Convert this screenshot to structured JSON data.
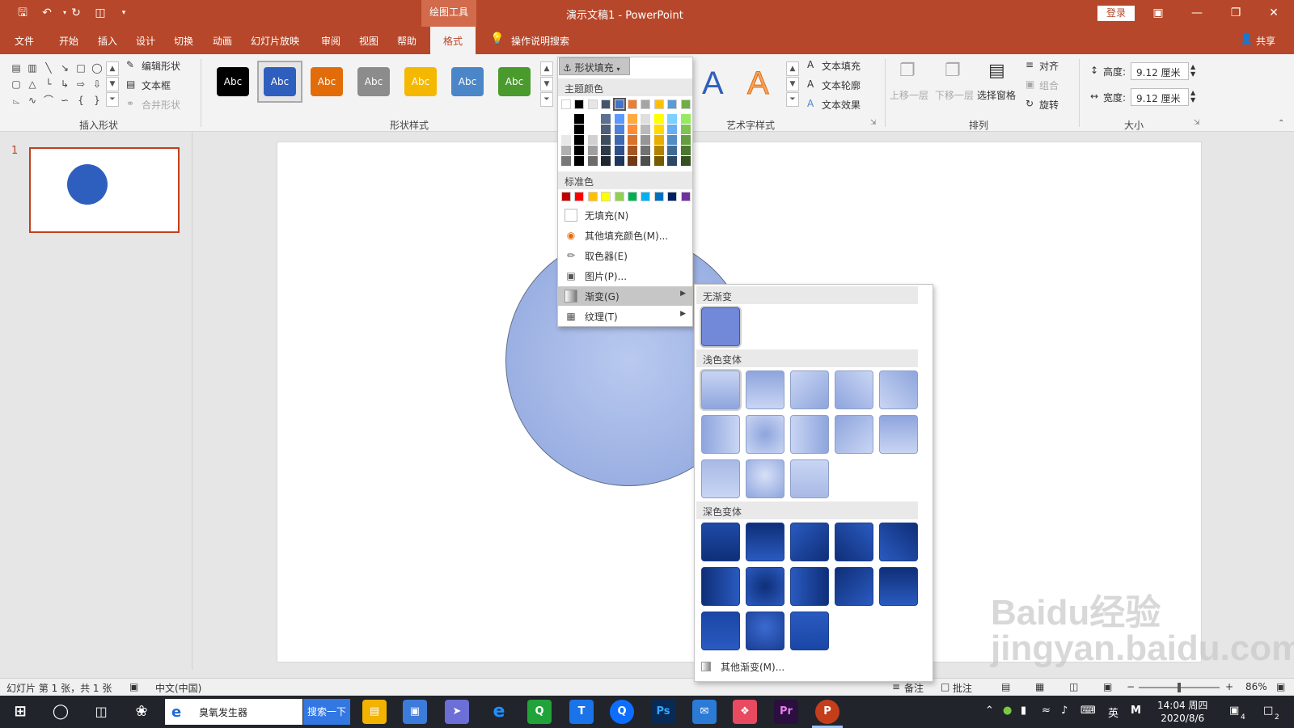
{
  "titlebar": {
    "context_tool": "绘图工具",
    "title": "演示文稿1 - PowerPoint",
    "login_label": "登录"
  },
  "tabs": [
    {
      "label": "文件"
    },
    {
      "label": "开始"
    },
    {
      "label": "插入"
    },
    {
      "label": "设计"
    },
    {
      "label": "切换"
    },
    {
      "label": "动画"
    },
    {
      "label": "幻灯片放映"
    },
    {
      "label": "审阅"
    },
    {
      "label": "视图"
    },
    {
      "label": "帮助"
    },
    {
      "label": "格式",
      "active": true
    }
  ],
  "search_label": "操作说明搜索",
  "share_label": "共享",
  "ribbon": {
    "insert_shapes": {
      "label": "插入形状",
      "edit_shape": "编辑形状",
      "text_box": "文本框",
      "merge_shapes": "合并形状"
    },
    "shape_styles": {
      "label": "形状样式",
      "abc_text": "Abc",
      "swatches": [
        "#000000",
        "#2f5fbe",
        "#e36c0a",
        "#8c8c8c",
        "#f5b800",
        "#4a86c8",
        "#4a9a2e"
      ]
    },
    "fill_button": "形状填充",
    "wordart": {
      "label": "艺术字样式",
      "text_fill": "文本填充",
      "text_outline": "文本轮廓",
      "text_effects": "文本效果"
    },
    "arrange": {
      "label": "排列",
      "bring_forward": "上移一层",
      "send_backward": "下移一层",
      "selection_pane": "选择窗格",
      "align": "对齐",
      "group": "组合",
      "rotate": "旋转"
    },
    "size": {
      "label": "大小",
      "height_label": "高度:",
      "height_value": "9.12 厘米",
      "width_label": "宽度:",
      "width_value": "9.12 厘米"
    }
  },
  "slide_panel": {
    "slide_number": "1"
  },
  "fill_menu": {
    "theme_colors_label": "主题颜色",
    "theme_colors": [
      "#ffffff",
      "#000000",
      "#e7e6e6",
      "#44546a",
      "#4472c4",
      "#ed7d31",
      "#a5a5a5",
      "#ffc000",
      "#5b9bd5",
      "#70ad47"
    ],
    "standard_colors_label": "标准色",
    "standard_colors": [
      "#c00000",
      "#ff0000",
      "#ffc000",
      "#ffff00",
      "#92d050",
      "#00b050",
      "#00b0f0",
      "#0070c0",
      "#002060",
      "#7030a0"
    ],
    "no_fill": "无填充(N)",
    "more_colors": "其他填充颜色(M)...",
    "eyedropper": "取色器(E)",
    "picture": "图片(P)...",
    "gradient": "渐变(G)",
    "texture": "纹理(T)"
  },
  "gradient_menu": {
    "no_gradient": "无渐变",
    "light_variations": "浅色变体",
    "dark_variations": "深色变体",
    "more_gradients": "其他渐变(M)..."
  },
  "statusbar": {
    "slide_info": "幻灯片 第 1 张，共 1 张",
    "language": "中文(中国)",
    "notes": "备注",
    "comments": "批注",
    "zoom": "86%"
  },
  "taskbar": {
    "search_text": "臭氧发生器",
    "search_button": "搜索一下",
    "ime": "英",
    "time": "14:04 周四",
    "date": "2020/8/6",
    "notification_count": "4",
    "message_count": "2"
  },
  "watermark": "Baidu经验 jingyan.baidu.com",
  "colors": {
    "accent": "#b7472a",
    "shape_fill": "#2f5fbe",
    "highlight": "#c6c6c6"
  }
}
